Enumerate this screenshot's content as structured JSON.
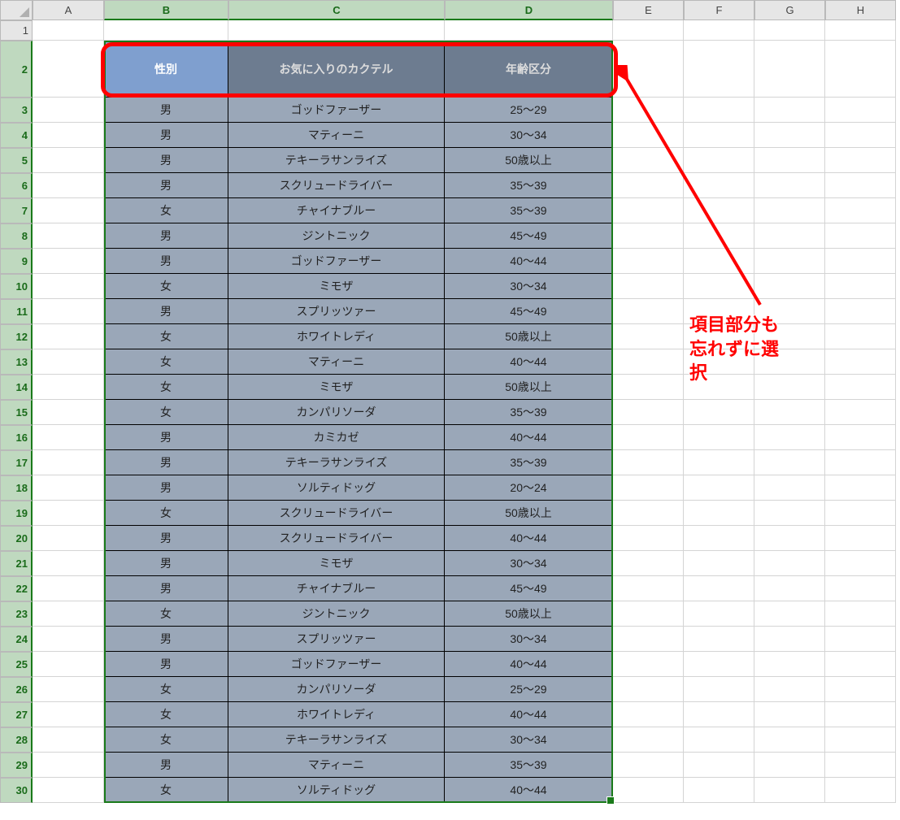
{
  "columns": [
    "A",
    "B",
    "C",
    "D",
    "E",
    "F",
    "G",
    "H"
  ],
  "row_numbers": [
    1,
    2,
    3,
    4,
    5,
    6,
    7,
    8,
    9,
    10,
    11,
    12,
    13,
    14,
    15,
    16,
    17,
    18,
    19,
    20,
    21,
    22,
    23,
    24,
    25,
    26,
    27,
    28,
    29,
    30
  ],
  "headers": {
    "b": "性別",
    "c": "お気に入りのカクテル",
    "d": "年齢区分"
  },
  "rows": [
    {
      "b": "男",
      "c": "ゴッドファーザー",
      "d": "25～29"
    },
    {
      "b": "男",
      "c": "マティーニ",
      "d": "30～34"
    },
    {
      "b": "男",
      "c": "テキーラサンライズ",
      "d": "50歳以上"
    },
    {
      "b": "男",
      "c": "スクリュードライバー",
      "d": "35～39"
    },
    {
      "b": "女",
      "c": "チャイナブルー",
      "d": "35～39"
    },
    {
      "b": "男",
      "c": "ジントニック",
      "d": "45～49"
    },
    {
      "b": "男",
      "c": "ゴッドファーザー",
      "d": "40～44"
    },
    {
      "b": "女",
      "c": "ミモザ",
      "d": "30～34"
    },
    {
      "b": "男",
      "c": "スプリッツァー",
      "d": "45～49"
    },
    {
      "b": "女",
      "c": "ホワイトレディ",
      "d": "50歳以上"
    },
    {
      "b": "女",
      "c": "マティーニ",
      "d": "40～44"
    },
    {
      "b": "女",
      "c": "ミモザ",
      "d": "50歳以上"
    },
    {
      "b": "女",
      "c": "カンパリソーダ",
      "d": "35～39"
    },
    {
      "b": "男",
      "c": "カミカゼ",
      "d": "40～44"
    },
    {
      "b": "男",
      "c": "テキーラサンライズ",
      "d": "35～39"
    },
    {
      "b": "男",
      "c": "ソルティドッグ",
      "d": "20～24"
    },
    {
      "b": "女",
      "c": "スクリュードライバー",
      "d": "50歳以上"
    },
    {
      "b": "男",
      "c": "スクリュードライバー",
      "d": "40～44"
    },
    {
      "b": "男",
      "c": "ミモザ",
      "d": "30～34"
    },
    {
      "b": "男",
      "c": "チャイナブルー",
      "d": "45～49"
    },
    {
      "b": "女",
      "c": "ジントニック",
      "d": "50歳以上"
    },
    {
      "b": "男",
      "c": "スプリッツァー",
      "d": "30～34"
    },
    {
      "b": "男",
      "c": "ゴッドファーザー",
      "d": "40～44"
    },
    {
      "b": "女",
      "c": "カンパリソーダ",
      "d": "25～29"
    },
    {
      "b": "女",
      "c": "ホワイトレディ",
      "d": "40～44"
    },
    {
      "b": "女",
      "c": "テキーラサンライズ",
      "d": "30～34"
    },
    {
      "b": "男",
      "c": "マティーニ",
      "d": "35～39"
    },
    {
      "b": "女",
      "c": "ソルティドッグ",
      "d": "40～44"
    }
  ],
  "annotation": {
    "text": "項目部分も\n忘れずに選\n択"
  }
}
